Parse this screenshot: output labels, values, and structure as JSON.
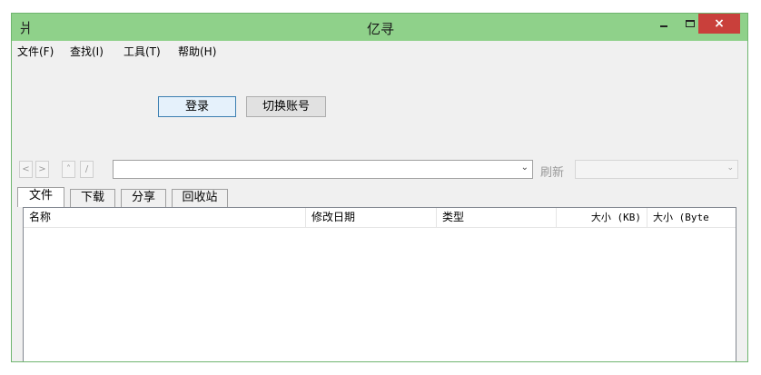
{
  "window": {
    "title": "亿寻",
    "icon": "app-glyph-icon",
    "app_glyph": "爿"
  },
  "titlebar": {
    "minimize": "minimize-icon",
    "maximize": "maximize-icon",
    "close_label": "×"
  },
  "menubar": {
    "items": [
      {
        "label": "文件(F)"
      },
      {
        "label": "查找(I)"
      },
      {
        "label": "工具(T)"
      },
      {
        "label": "帮助(H)"
      }
    ]
  },
  "actions": {
    "login_label": "登录",
    "switch_label": "切换账号"
  },
  "navbar": {
    "back": "<",
    "forward": ">",
    "up": "˄",
    "root": "/",
    "path_value": "",
    "path_arrow": "⌄",
    "refresh_label": "刷新",
    "right_combo_value": "",
    "right_arrow": "⌄"
  },
  "tabs": [
    {
      "label": "文件",
      "active": true
    },
    {
      "label": "下载"
    },
    {
      "label": "分享"
    },
    {
      "label": "回收站"
    }
  ],
  "list": {
    "columns": [
      {
        "label": "名称"
      },
      {
        "label": "修改日期"
      },
      {
        "label": "类型"
      },
      {
        "label": "大小 (KB)"
      },
      {
        "label": "大小 (Byte"
      }
    ],
    "rows": []
  },
  "colors": {
    "titlebar": "#8fd18a",
    "close": "#c9403b",
    "accent": "#3c7fb1"
  }
}
